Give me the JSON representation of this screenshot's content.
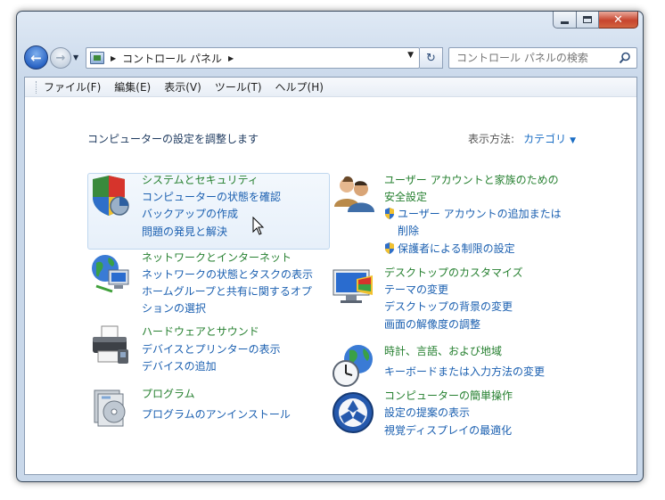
{
  "address": {
    "crumb": "コントロール パネル"
  },
  "search": {
    "placeholder": "コントロール パネルの検索"
  },
  "menu": [
    "ファイル(F)",
    "編集(E)",
    "表示(V)",
    "ツール(T)",
    "ヘルプ(H)"
  ],
  "page": {
    "adjust_label": "コンピューターの設定を調整します",
    "view_label": "表示方法:",
    "view_value": "カテゴリ"
  },
  "left_categories": [
    {
      "title": "システムとセキュリティ",
      "links": [
        "コンピューターの状態を確認",
        "バックアップの作成",
        "問題の発見と解決"
      ],
      "icon": "shield-pie-icon"
    },
    {
      "title": "ネットワークとインターネット",
      "links": [
        "ネットワークの状態とタスクの表示",
        "ホームグループと共有に関するオプ",
        "ションの選択"
      ],
      "icon": "network-globe-icon"
    },
    {
      "title": "ハードウェアとサウンド",
      "links": [
        "デバイスとプリンターの表示",
        "デバイスの追加"
      ],
      "icon": "printer-icon"
    },
    {
      "title": "プログラム",
      "links": [
        "プログラムのアンインストール"
      ],
      "icon": "programs-icon"
    }
  ],
  "right_categories": [
    {
      "title_lines": [
        "ユーザー アカウントと家族のための",
        "安全設定"
      ],
      "links": [
        "ユーザー アカウントの追加または",
        "削除",
        "保護者による制限の設定"
      ],
      "icon": "users-icon"
    },
    {
      "title_lines": [
        "デスクトップのカスタマイズ"
      ],
      "links": [
        "テーマの変更",
        "デスクトップの背景の変更",
        "画面の解像度の調整"
      ],
      "icon": "desktop-icon"
    },
    {
      "title_lines": [
        "時計、言語、および地域"
      ],
      "links": [
        "キーボードまたは入力方法の変更"
      ],
      "icon": "clock-globe-icon"
    },
    {
      "title_lines": [
        "コンピューターの簡単操作"
      ],
      "links": [
        "設定の提案の表示",
        "視覚ディスプレイの最適化"
      ],
      "icon": "ease-of-access-icon"
    }
  ]
}
